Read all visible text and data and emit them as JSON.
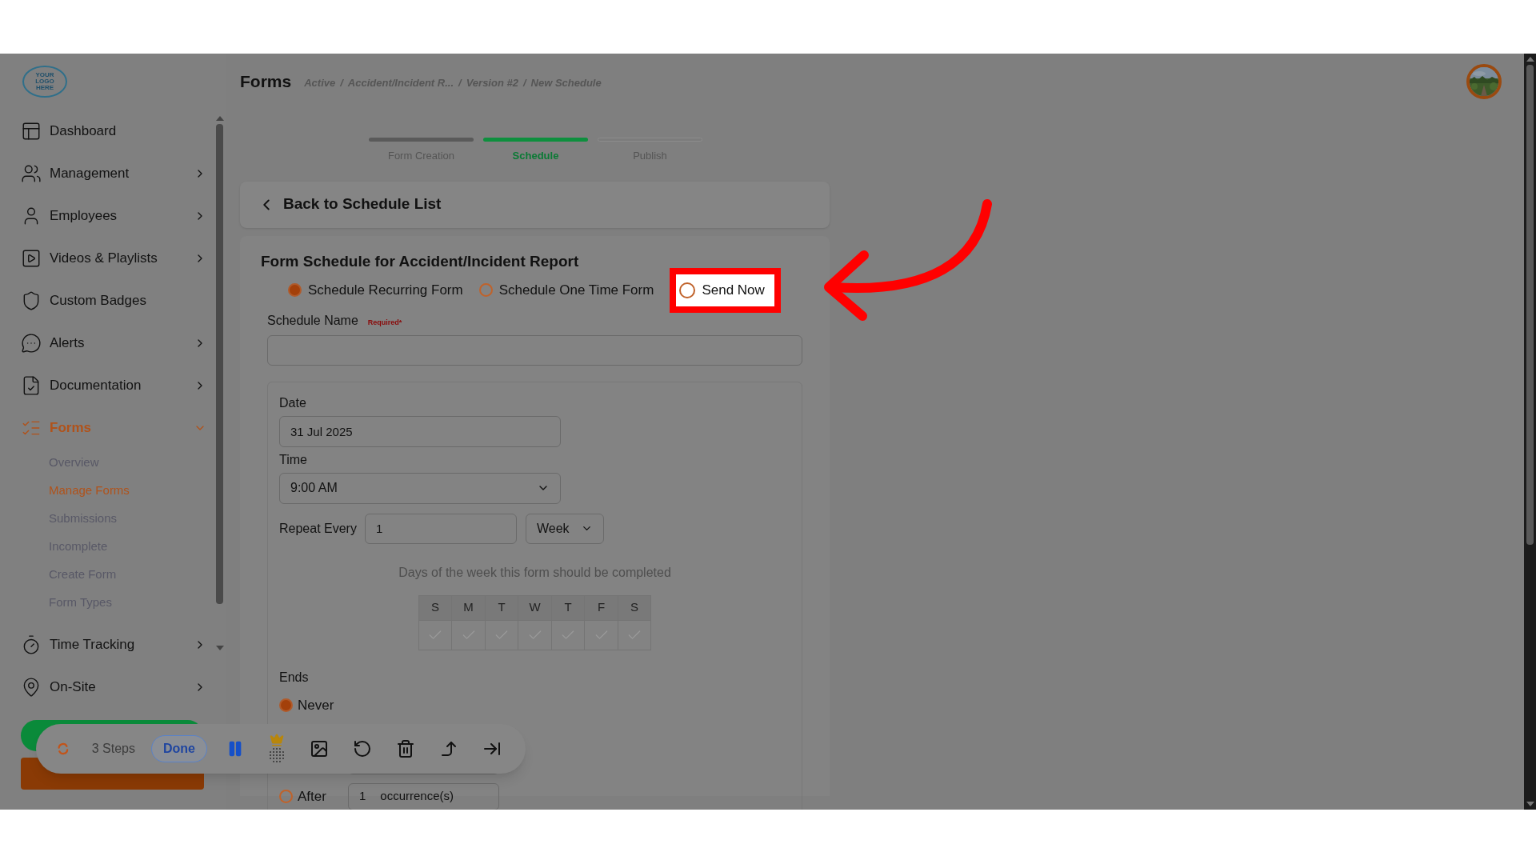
{
  "logo": "YOUR LOGO HERE",
  "sidebar": {
    "items": [
      {
        "label": "Dashboard",
        "expandable": false,
        "selected": false
      },
      {
        "label": "Management",
        "expandable": true,
        "expanded": false,
        "selected": false
      },
      {
        "label": "Employees",
        "expandable": true,
        "expanded": false,
        "selected": false
      },
      {
        "label": "Videos & Playlists",
        "expandable": true,
        "expanded": false,
        "selected": false
      },
      {
        "label": "Custom Badges",
        "expandable": false,
        "selected": false
      },
      {
        "label": "Alerts",
        "expandable": true,
        "expanded": false,
        "selected": false
      },
      {
        "label": "Documentation",
        "expandable": true,
        "expanded": false,
        "selected": false
      },
      {
        "label": "Forms",
        "expandable": true,
        "expanded": true,
        "selected": true,
        "children": [
          {
            "label": "Overview",
            "selected": false
          },
          {
            "label": "Manage Forms",
            "selected": true
          },
          {
            "label": "Submissions",
            "selected": false
          },
          {
            "label": "Incomplete",
            "selected": false
          },
          {
            "label": "Create Form",
            "selected": false
          },
          {
            "label": "Form Types",
            "selected": false
          }
        ]
      },
      {
        "label": "Time Tracking",
        "expandable": true,
        "expanded": false,
        "selected": false
      },
      {
        "label": "On-Site",
        "expandable": true,
        "expanded": false,
        "selected": false
      }
    ]
  },
  "header": {
    "title": "Forms",
    "separator": "/",
    "breadcrumb": [
      "Active",
      "Accident/Incident R...",
      "Version #2",
      "New Schedule"
    ]
  },
  "steps": [
    {
      "label": "Form Creation",
      "completed": true,
      "selected": false
    },
    {
      "label": "Schedule",
      "completed": false,
      "selected": true
    },
    {
      "label": "Publish",
      "completed": false,
      "selected": false
    }
  ],
  "back_link": "Back to Schedule List",
  "form": {
    "title": "Form Schedule for Accident/Incident Report",
    "modes": [
      {
        "label": "Schedule Recurring Form",
        "selected": true,
        "highlighted": false
      },
      {
        "label": "Schedule One Time Form",
        "selected": false,
        "highlighted": false
      },
      {
        "label": "Send Now",
        "selected": false,
        "highlighted": true
      }
    ],
    "schedule_name": {
      "label": "Schedule Name",
      "required_note": "Required*"
    },
    "date": {
      "label": "Date",
      "value": "31 Jul 2025"
    },
    "time": {
      "label": "Time",
      "value": "9:00 AM"
    },
    "repeat": {
      "label": "Repeat Every",
      "value": "1",
      "unit": "Week"
    },
    "days": {
      "caption": "Days of the week this form should be completed",
      "items": [
        {
          "label": "S",
          "checked": false
        },
        {
          "label": "M",
          "checked": false
        },
        {
          "label": "T",
          "checked": false
        },
        {
          "label": "W",
          "checked": false
        },
        {
          "label": "T",
          "checked": false
        },
        {
          "label": "F",
          "checked": false
        },
        {
          "label": "S",
          "checked": false
        }
      ]
    },
    "ends": {
      "label": "Ends",
      "options": [
        {
          "label": "Never",
          "selected": true
        },
        {
          "label": "After",
          "selected": false,
          "value": "1",
          "unit": "occurrence(s)"
        }
      ]
    }
  },
  "recorder": {
    "steps": "3 Steps",
    "done": "Done"
  }
}
